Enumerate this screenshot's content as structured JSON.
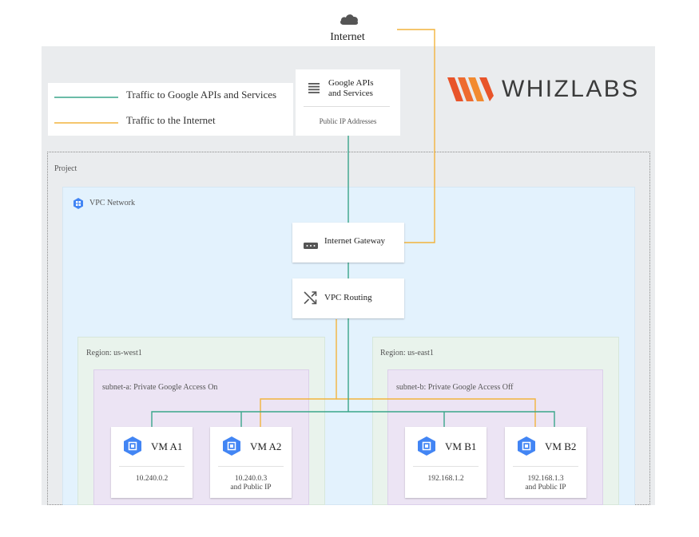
{
  "internet": {
    "label": "Internet"
  },
  "legend": {
    "google_traffic": "Traffic to Google APIs and Services",
    "internet_traffic": "Traffic to the Internet"
  },
  "google_apis": {
    "title_line1": "Google APIs",
    "title_line2": "and Services",
    "subtitle": "Public IP Addresses"
  },
  "brand": {
    "name": "WHIZLABS"
  },
  "project": {
    "label": "Project"
  },
  "vpc": {
    "label": "VPC Network"
  },
  "internet_gateway": {
    "label": "Internet Gateway"
  },
  "vpc_routing": {
    "label": "VPC Routing"
  },
  "regions": [
    {
      "label": "Region: us-west1",
      "subnet": "subnet-a: Private Google Access On",
      "vms": [
        {
          "name": "VM A1",
          "ip_line1": "10.240.0.2",
          "ip_line2": ""
        },
        {
          "name": "VM A2",
          "ip_line1": "10.240.0.3",
          "ip_line2": "and Public IP"
        }
      ]
    },
    {
      "label": "Region: us-east1",
      "subnet": "subnet-b: Private Google Access Off",
      "vms": [
        {
          "name": "VM B1",
          "ip_line1": "192.168.1.2",
          "ip_line2": ""
        },
        {
          "name": "VM B2",
          "ip_line1": "192.168.1.3",
          "ip_line2": "and Public IP"
        }
      ]
    }
  ],
  "colors": {
    "google_line": "#3aa68a",
    "internet_line": "#f2b33d",
    "brand_orange": "#e8542a",
    "hex_blue": "#4285f4"
  }
}
